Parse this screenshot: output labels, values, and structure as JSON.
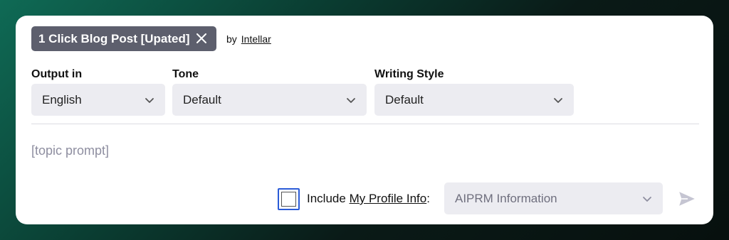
{
  "prompt": {
    "title": "1 Click Blog Post [Upated]",
    "by_label": "by",
    "author": "Intellar"
  },
  "fields": {
    "output": {
      "label": "Output in",
      "value": "English"
    },
    "tone": {
      "label": "Tone",
      "value": "Default"
    },
    "style": {
      "label": "Writing Style",
      "value": "Default"
    }
  },
  "topic_placeholder": "[topic prompt]",
  "include": {
    "prefix": "Include",
    "link": "My Profile Info",
    "suffix": ":",
    "checked": false
  },
  "profile_select": {
    "value": "AIPRM Information"
  },
  "colors": {
    "accent": "#2a5bd7",
    "chip": "#5d5f6d",
    "select_bg": "#ececf1"
  },
  "icons": [
    "close-icon",
    "chevron-down-icon",
    "send-icon"
  ]
}
